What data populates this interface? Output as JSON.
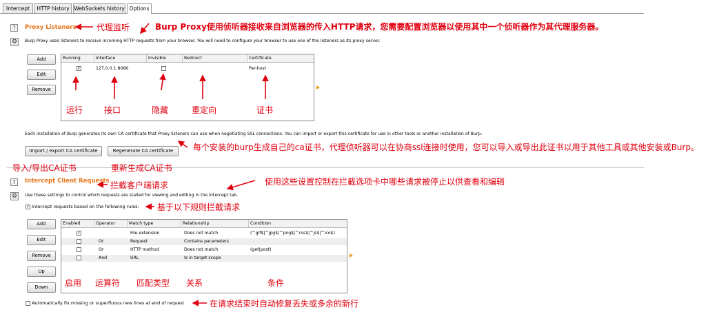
{
  "tabs": [
    {
      "label": "Intercept",
      "active": false
    },
    {
      "label": "HTTP history",
      "active": false
    },
    {
      "label": "WebSockets history",
      "active": false
    },
    {
      "label": "Options",
      "active": true
    }
  ],
  "proxy_listeners": {
    "title": "Proxy Listeners",
    "description": "Burp Proxy uses listeners to receive incoming HTTP requests from your browser. You will need to configure your browser to use one of the listeners as its proxy server.",
    "buttons": {
      "add": "Add",
      "edit": "Edit",
      "remove": "Remove"
    },
    "columns": [
      "Running",
      "Interface",
      "Invisible",
      "Redirect",
      "Certificate"
    ],
    "rows": [
      {
        "running": true,
        "interface": "127.0.0.1:8080",
        "invisible": false,
        "redirect": "",
        "certificate": "Per-host"
      }
    ],
    "ca_text": "Each installation of Burp generates its own CA certificate that Proxy listeners can use when negotiating SSL connections. You can import or export this certificate for use in other tools or another installation of Burp.",
    "import_export_label": "Import / export CA certificate",
    "regenerate_label": "Regenerate CA certificate"
  },
  "intercept_client": {
    "title": "Intercept Client Requests",
    "description": "Use these settings to control which requests are stalled for viewing and editing in the Intercept tab.",
    "rule_checkbox_label": "Intercept requests based on the following rules:",
    "buttons": {
      "add": "Add",
      "edit": "Edit",
      "remove": "Remove",
      "up": "Up",
      "down": "Down"
    },
    "columns": [
      "Enabled",
      "Operator",
      "Match type",
      "Relationship",
      "Condition"
    ],
    "rows": [
      {
        "enabled": true,
        "operator": "",
        "match_type": "File extension",
        "relationship": "Does not match",
        "condition": "(^gif$|^jpg$|^png$|^css$|^js$|^ico$)"
      },
      {
        "enabled": false,
        "operator": "Or",
        "match_type": "Request",
        "relationship": "Contains parameters",
        "condition": ""
      },
      {
        "enabled": false,
        "operator": "Or",
        "match_type": "HTTP method",
        "relationship": "Does not match",
        "condition": "(get|post)"
      },
      {
        "enabled": false,
        "operator": "And",
        "match_type": "URL",
        "relationship": "Is in target scope",
        "condition": ""
      }
    ],
    "fix_newlines_label": "Automatically fix missing or superfluous new lines at end of request"
  },
  "annotations": {
    "proxy_listener": "代理监听",
    "burp_proxy_note": "Burp Proxy使用侦听器接收来自浏览器的传入HTTP请求，您需要配置浏览器以使用其中一个侦听器作为其代理服务器。",
    "running": "运行",
    "interface": "接口",
    "invisible": "隐藏",
    "redirect": "重定向",
    "certificate": "证书",
    "ca_note": "每个安装的burp生成自己的ca证书，代理侦听器可以在协商ssl连接时使用，您可以导入或导出此证书以用于其他工具或其他安装或Burp。",
    "import_export": "导入/导出CA证书",
    "regenerate": "重新生成CA证书",
    "intercept_client": "拦截客户端请求",
    "intercept_desc": "使用这些设置控制在拦截选项卡中哪些请求被停止以供查看和编辑",
    "rules": "基于以下规则拦截请求",
    "enabled": "启用",
    "operator": "运算符",
    "match_type": "匹配类型",
    "relationship": "关系",
    "condition": "条件",
    "fix_newlines": "在请求结束时自动修复丢失或多余的新行"
  },
  "colors": {
    "annotation": "#e0000e",
    "section_title": "#e8751a",
    "triangle": "#e59a1a"
  }
}
